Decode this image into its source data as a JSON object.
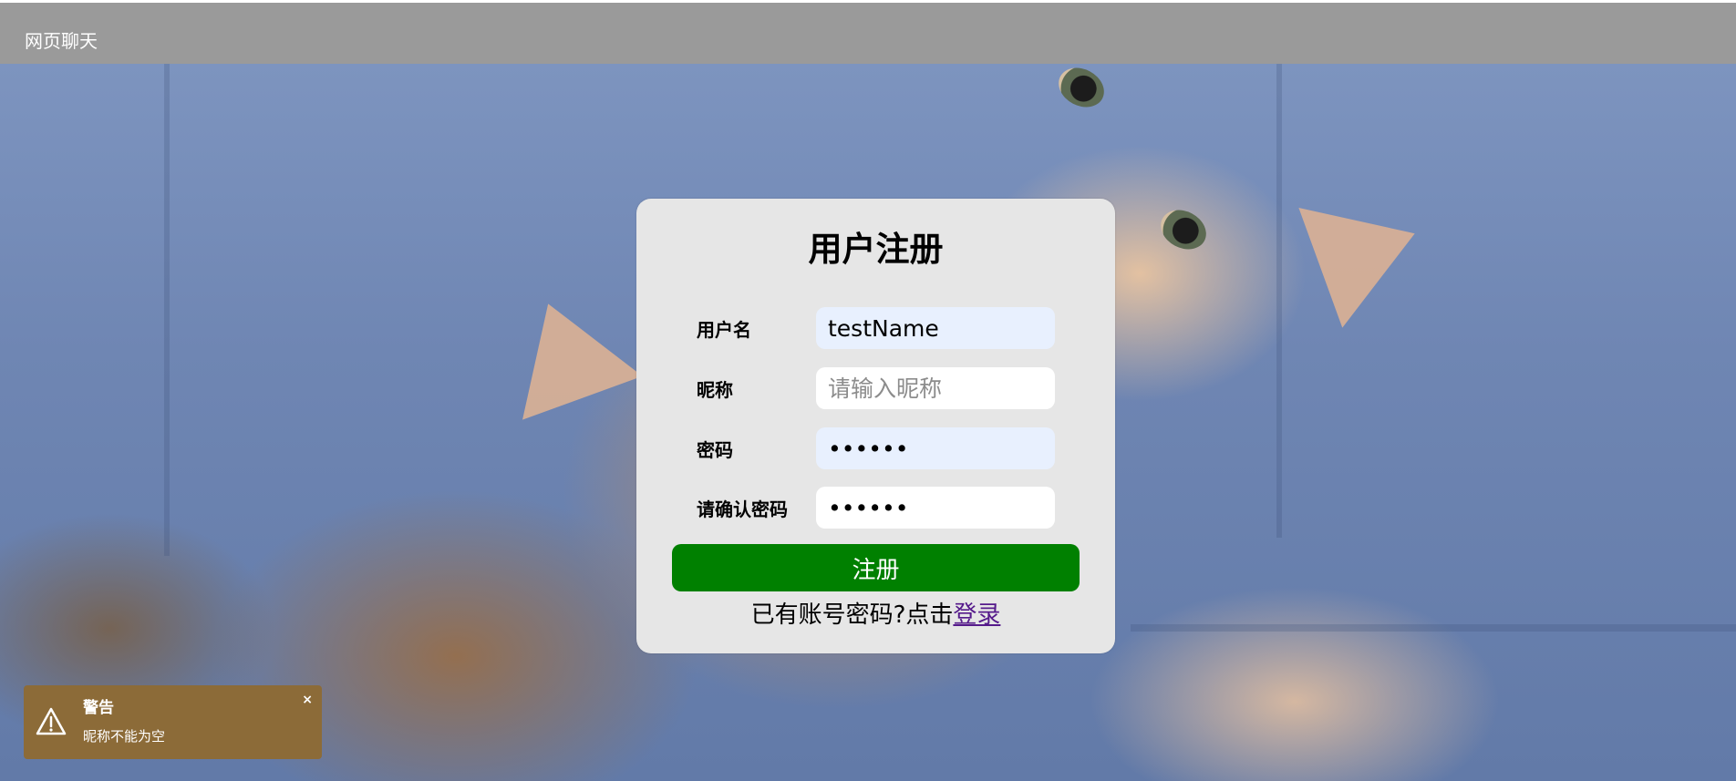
{
  "header": {
    "title": "网页聊天"
  },
  "register_form": {
    "title": "用户注册",
    "fields": [
      {
        "label": "用户名",
        "value": "testName",
        "placeholder": "",
        "type": "text"
      },
      {
        "label": "昵称",
        "value": "",
        "placeholder": "请输入昵称",
        "type": "text"
      },
      {
        "label": "密码",
        "value": "••••••",
        "placeholder": "",
        "type": "password"
      },
      {
        "label": "请确认密码",
        "value": "••••••",
        "placeholder": "",
        "type": "password"
      }
    ],
    "submit_label": "注册",
    "login_hint": "已有账号密码?点击",
    "login_link": "登录",
    "accent_color": "#008000"
  },
  "toast": {
    "title": "警告",
    "message": "昵称不能为空",
    "close_label": "×",
    "icon": "warning-icon",
    "color": "#8c6b38"
  }
}
